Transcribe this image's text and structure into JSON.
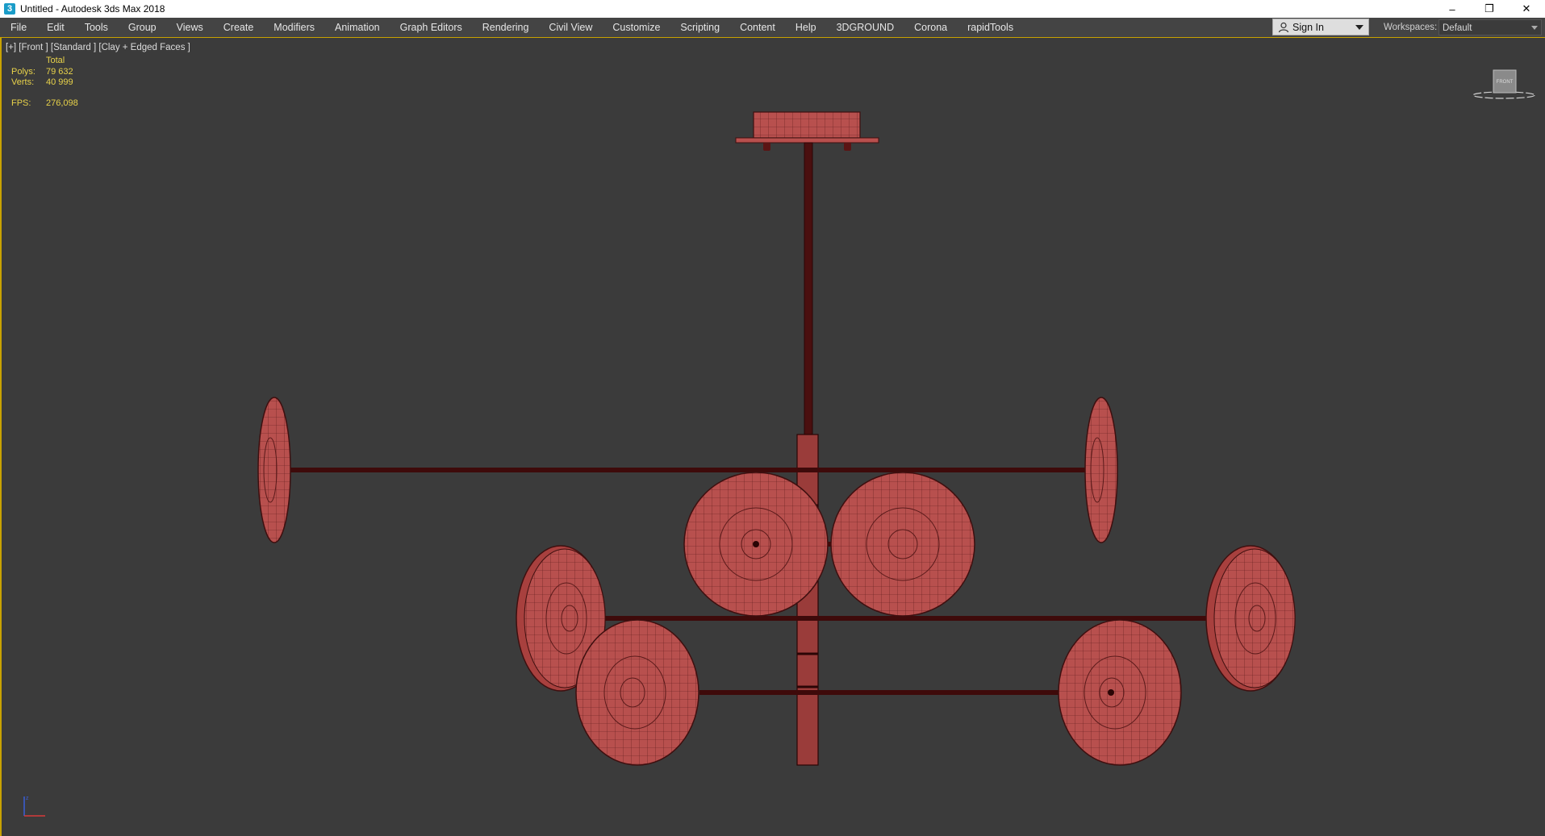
{
  "window": {
    "title": "Untitled - Autodesk 3ds Max 2018",
    "controls": {
      "minimize": "–",
      "restore": "❐",
      "close": "✕"
    }
  },
  "menu": {
    "items": [
      "File",
      "Edit",
      "Tools",
      "Group",
      "Views",
      "Create",
      "Modifiers",
      "Animation",
      "Graph Editors",
      "Rendering",
      "Civil View",
      "Customize",
      "Scripting",
      "Content",
      "Help",
      "3DGROUND",
      "Corona",
      "rapidTools"
    ]
  },
  "account": {
    "sign_in_label": "Sign In"
  },
  "workspaces": {
    "label": "Workspaces:",
    "value": "Default"
  },
  "viewport": {
    "label": "[+] [Front ] [Standard ] [Clay + Edged Faces ]",
    "stats": {
      "total_label": "Total",
      "polys_label": "Polys:",
      "polys_value": "79 632",
      "verts_label": "Verts:",
      "verts_value": "40 999",
      "fps_label": "FPS:",
      "fps_value": "276,098"
    },
    "viewcube_label": "FRONT"
  },
  "colors": {
    "model_fill": "#b8504e",
    "model_edge": "#3e0f0f",
    "accent_border": "#c8a200",
    "stats_text": "#e8d24a"
  }
}
